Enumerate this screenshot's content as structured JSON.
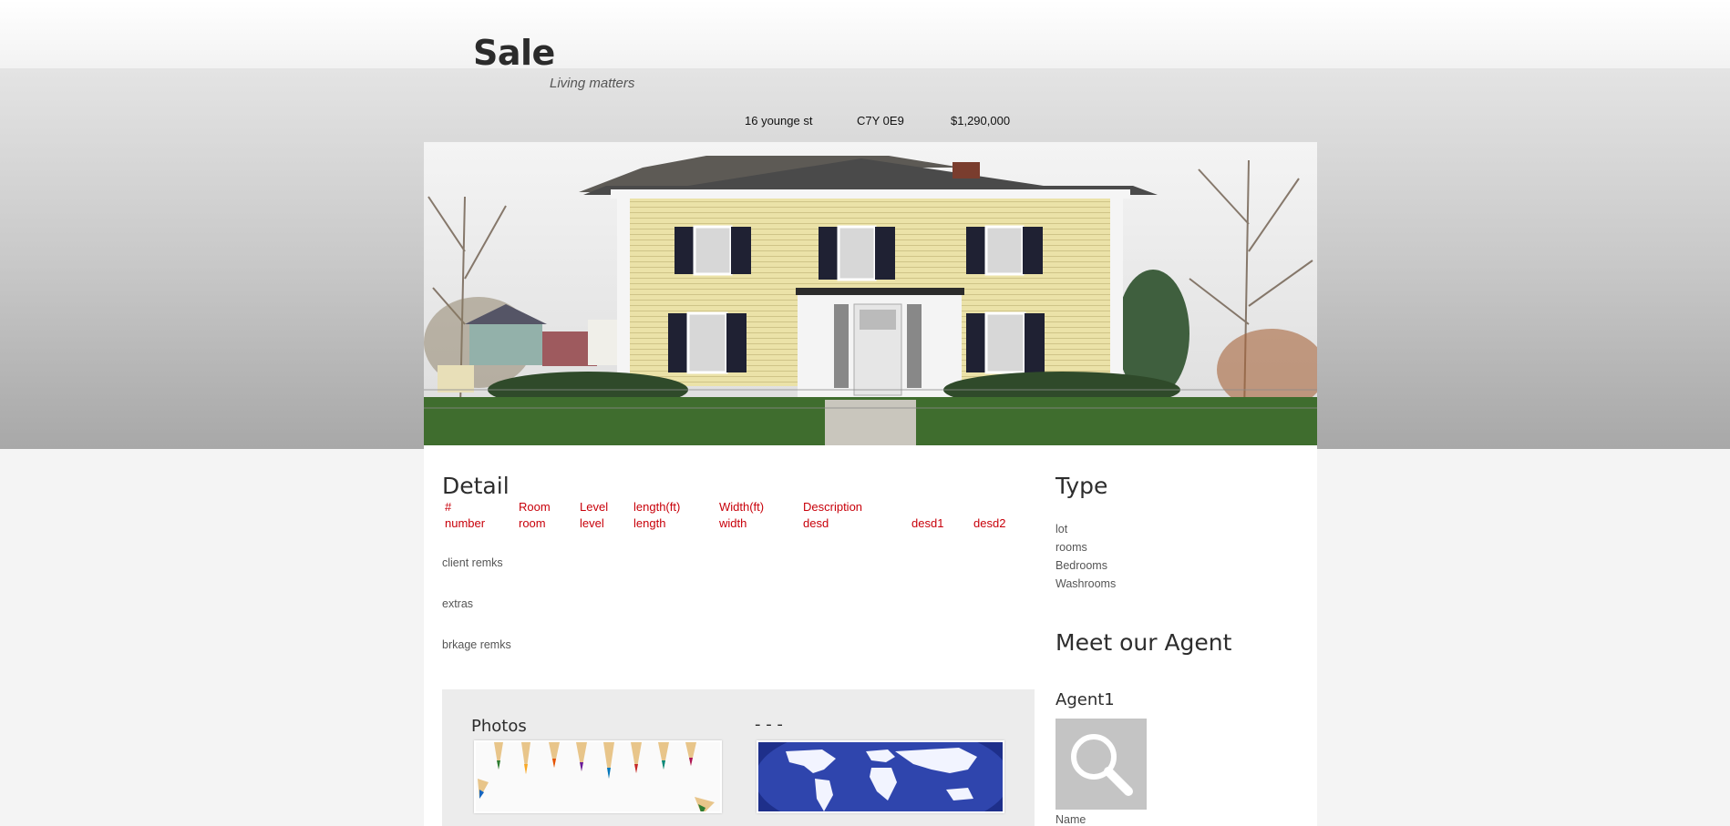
{
  "header": {
    "title": "Sale",
    "tagline": "Living matters"
  },
  "listing": {
    "address": "16 younge st",
    "postal_code": "C7Y 0E9",
    "price": "$1,290,000"
  },
  "detail": {
    "heading": "Detail",
    "columns": [
      "#",
      "Room",
      "Level",
      "length(ft)",
      "Width(ft)",
      "Description"
    ],
    "row": [
      "number",
      "room",
      "level",
      "length",
      "width",
      "desd",
      "desd1",
      "desd2"
    ],
    "client_remarks": "client remks",
    "extras": "extras",
    "brokerage_remarks": "brkage remks"
  },
  "gallery": {
    "photos_heading": "Photos",
    "second_heading": "- - -"
  },
  "type": {
    "heading": "Type",
    "items": [
      "lot",
      "rooms",
      "Bedrooms",
      "Washrooms"
    ]
  },
  "agent": {
    "heading": "Meet our Agent",
    "name_heading": "Agent1",
    "name_label": "Name"
  },
  "colors": {
    "label_red": "#c8000a",
    "heading_dark": "#2d2d2d"
  }
}
